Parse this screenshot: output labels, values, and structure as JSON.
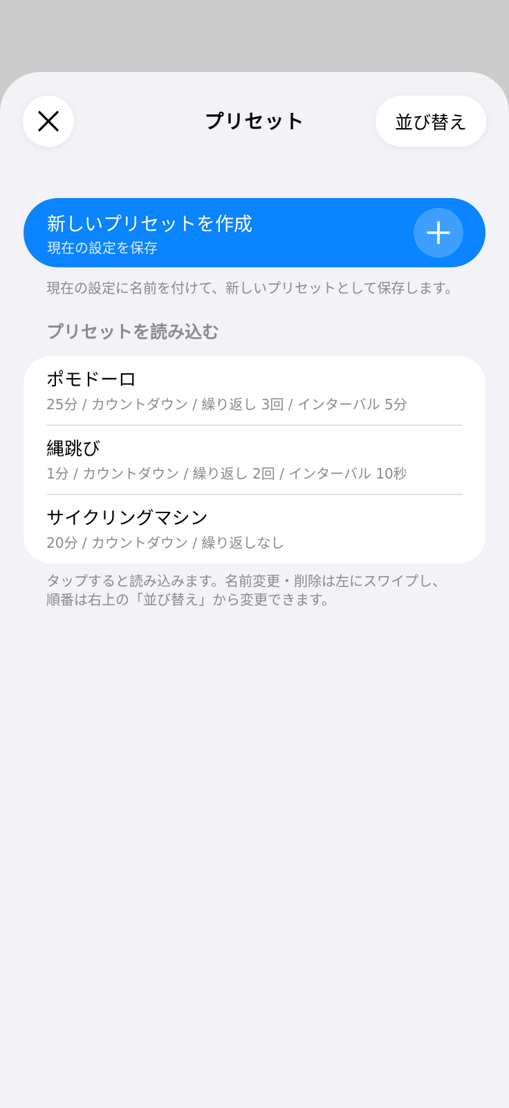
{
  "nav": {
    "title": "プリセット",
    "close_icon": "close-icon",
    "reorder_label": "並び替え"
  },
  "create": {
    "title": "新しいプリセットを作成",
    "subtitle": "現在の設定を保存",
    "plus_icon": "plus-icon",
    "footnote": "現在の設定に名前を付けて、新しいプリセットとして保存します。"
  },
  "load_section": {
    "header": "プリセットを読み込む",
    "items": [
      {
        "name": "ポモドーロ",
        "detail": "25分 / カウントダウン / 繰り返し 3回 / インターバル 5分"
      },
      {
        "name": "縄跳び",
        "detail": "1分 / カウントダウン / 繰り返し 2回 / インターバル 10秒"
      },
      {
        "name": "サイクリングマシン",
        "detail": "20分 / カウントダウン / 繰り返しなし"
      }
    ],
    "footer_line1": "タップすると読み込みます。名前変更・削除は左にスワイプし、",
    "footer_line2": "順番は右上の「並び替え」から変更できます。"
  },
  "colors": {
    "accent": "#0a84ff",
    "sheet_background": "#f2f2f7",
    "secondary_text": "#8a8a8e",
    "dimmed_backdrop": "#cbcbcb"
  }
}
